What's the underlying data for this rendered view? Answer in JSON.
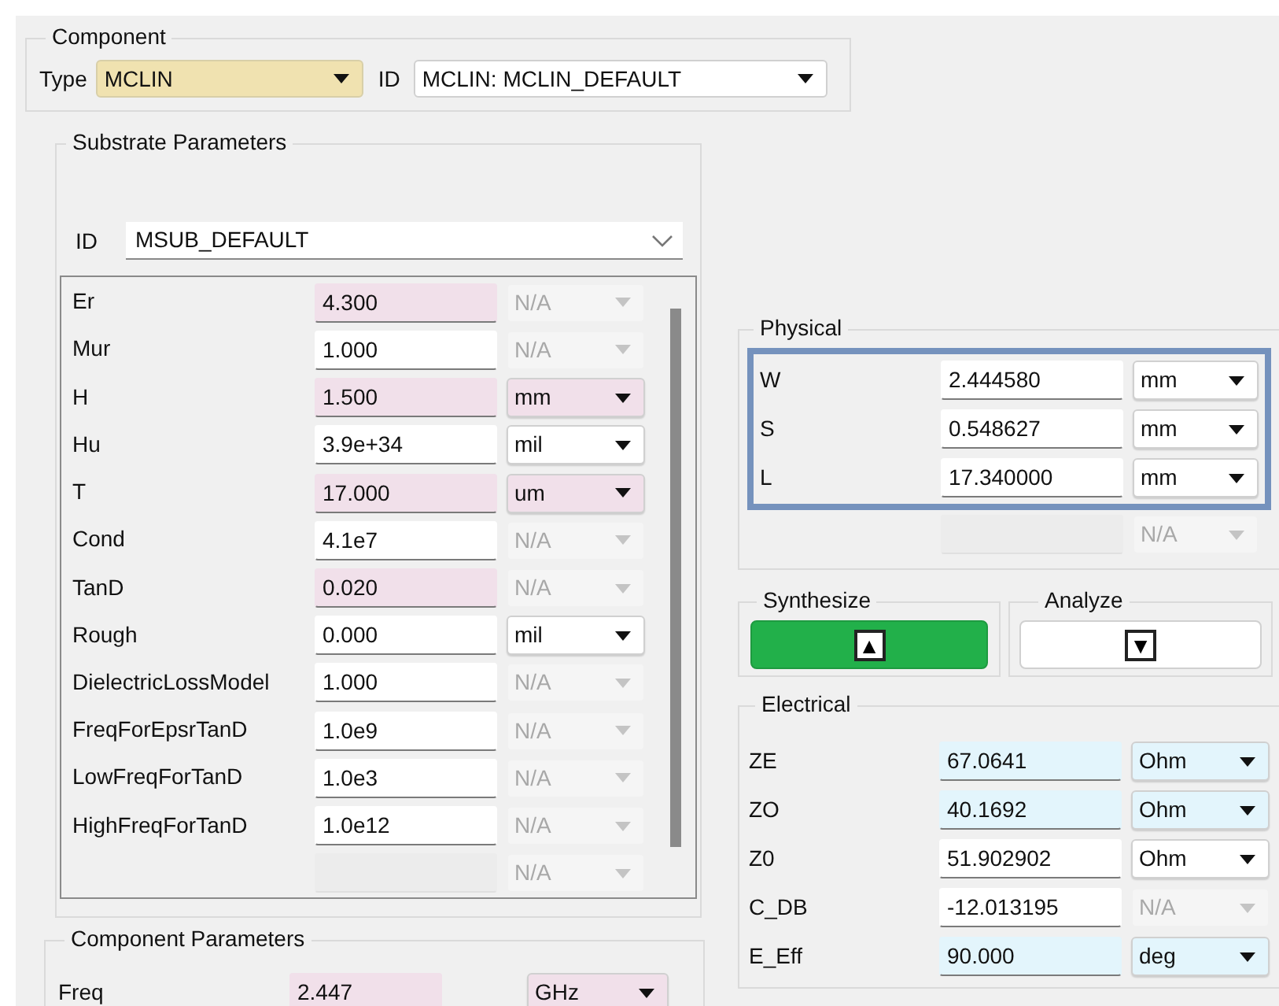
{
  "component": {
    "title": "Component",
    "type_label": "Type",
    "type_value": "MCLIN",
    "id_label": "ID",
    "id_value": "MCLIN: MCLIN_DEFAULT"
  },
  "substrate": {
    "title": "Substrate Parameters",
    "id_label": "ID",
    "id_value": "MSUB_DEFAULT",
    "rows": [
      {
        "name": "Er",
        "value": "4.300",
        "color": "#f1e0ea",
        "unit": {
          "value": "N/A",
          "disabled": true
        }
      },
      {
        "name": "Mur",
        "value": "1.000",
        "color": "#ffffff",
        "unit": {
          "value": "N/A",
          "disabled": true
        }
      },
      {
        "name": "H",
        "value": "1.500",
        "color": "#f1e0ea",
        "unit": {
          "value": "mm",
          "disabled": false,
          "color": "#f1e0ea"
        }
      },
      {
        "name": "Hu",
        "value": "3.9e+34",
        "color": "#ffffff",
        "unit": {
          "value": "mil",
          "disabled": false,
          "color": "#ffffff"
        }
      },
      {
        "name": "T",
        "value": "17.000",
        "color": "#f1e0ea",
        "unit": {
          "value": "um",
          "disabled": false,
          "color": "#f1e0ea"
        }
      },
      {
        "name": "Cond",
        "value": "4.1e7",
        "color": "#ffffff",
        "unit": {
          "value": "N/A",
          "disabled": true
        }
      },
      {
        "name": "TanD",
        "value": "0.020",
        "color": "#f1e0ea",
        "unit": {
          "value": "N/A",
          "disabled": true
        }
      },
      {
        "name": "Rough",
        "value": "0.000",
        "color": "#ffffff",
        "unit": {
          "value": "mil",
          "disabled": false,
          "color": "#ffffff"
        }
      },
      {
        "name": "DielectricLossModel",
        "value": "1.000",
        "color": "#ffffff",
        "unit": {
          "value": "N/A",
          "disabled": true
        }
      },
      {
        "name": "FreqForEpsrTanD",
        "value": "1.0e9",
        "color": "#ffffff",
        "unit": {
          "value": "N/A",
          "disabled": true
        }
      },
      {
        "name": "LowFreqForTanD",
        "value": "1.0e3",
        "color": "#ffffff",
        "unit": {
          "value": "N/A",
          "disabled": true
        }
      },
      {
        "name": "HighFreqForTanD",
        "value": "1.0e12",
        "color": "#ffffff",
        "unit": {
          "value": "N/A",
          "disabled": true
        }
      },
      {
        "color": "#ececec",
        "unit": {
          "value": "N/A",
          "disabled": true
        }
      }
    ]
  },
  "component_parameters": {
    "title": "Component Parameters",
    "rows": [
      {
        "name": "Freq",
        "value": "2.447",
        "color": "#f1e0ea",
        "unit": {
          "value": "GHz",
          "disabled": false,
          "color": "#f1e0ea"
        }
      }
    ]
  },
  "physical": {
    "title": "Physical",
    "rows": [
      {
        "name": "W",
        "value": "2.444580",
        "color": "#ffffff",
        "unit": {
          "value": "mm",
          "disabled": false,
          "color": "#ffffff"
        }
      },
      {
        "name": "S",
        "value": "0.548627",
        "color": "#ffffff",
        "unit": {
          "value": "mm",
          "disabled": false,
          "color": "#ffffff"
        }
      },
      {
        "name": "L",
        "value": "17.340000",
        "color": "#ffffff",
        "unit": {
          "value": "mm",
          "disabled": false,
          "color": "#ffffff"
        }
      }
    ],
    "extra_row": {
      "color": "#ececec",
      "unit": {
        "value": "N/A",
        "disabled": true
      }
    }
  },
  "synthesize": {
    "title": "Synthesize",
    "symbol": "▲",
    "active": true
  },
  "analyze": {
    "title": "Analyze",
    "symbol": "▼",
    "active": false
  },
  "electrical": {
    "title": "Electrical",
    "rows": [
      {
        "name": "ZE",
        "value": "67.0641",
        "color": "#e3f5fc",
        "unit": {
          "value": "Ohm",
          "disabled": false,
          "color": "#e3f5fc"
        }
      },
      {
        "name": "ZO",
        "value": "40.1692",
        "color": "#e3f5fc",
        "unit": {
          "value": "Ohm",
          "disabled": false,
          "color": "#e3f5fc"
        }
      },
      {
        "name": "Z0",
        "value": "51.902902",
        "color": "#ffffff",
        "unit": {
          "value": "Ohm",
          "disabled": false,
          "color": "#ffffff"
        }
      },
      {
        "name": "C_DB",
        "value": "-12.013195",
        "color": "#ffffff",
        "unit": {
          "value": "N/A",
          "disabled": true
        }
      },
      {
        "name": "E_Eff",
        "value": "90.000",
        "color": "#e3f5fc",
        "unit": {
          "value": "deg",
          "disabled": false,
          "color": "#e3f5fc"
        }
      }
    ]
  }
}
